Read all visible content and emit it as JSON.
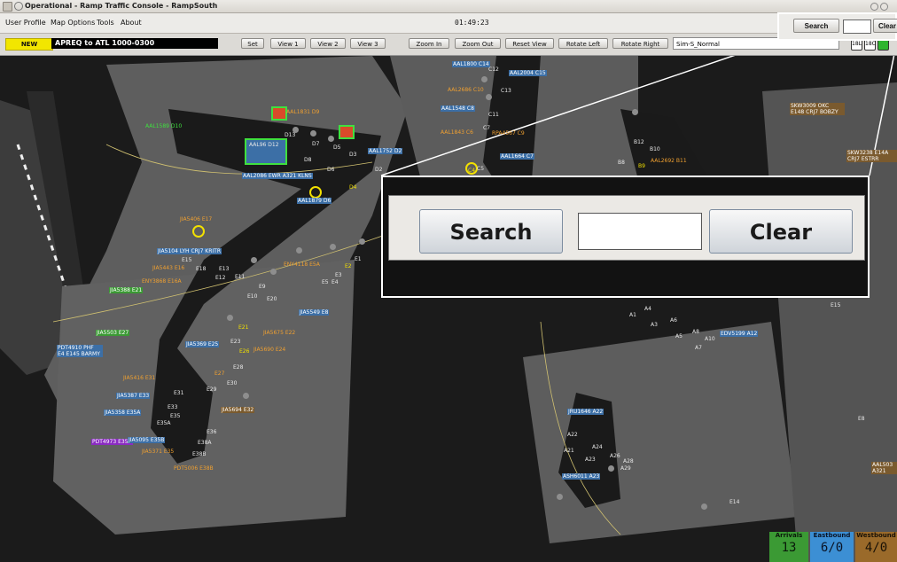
{
  "window": {
    "title": "Operational - Ramp Traffic Console - RampSouth"
  },
  "menu": {
    "items": [
      "User Profile",
      "Map Options",
      "Tools",
      "About"
    ],
    "clock": "01:49:23"
  },
  "toolbar": {
    "new_label": "NEW",
    "apreq_text": "APREQ to ATL 1000-0300",
    "buttons": [
      "Set",
      "View 1",
      "View 2",
      "View 3",
      "Zoom In",
      "Zoom Out",
      "Reset View",
      "Rotate Left",
      "Rotate Right"
    ],
    "sim_value": "Sim-S_Normal",
    "icons": [
      "18L",
      "18C"
    ]
  },
  "search": {
    "search_label": "Search",
    "clear_label": "Clear",
    "value": ""
  },
  "zoom_callout": {
    "search_label": "Search",
    "clear_label": "Clear",
    "value": ""
  },
  "counters": {
    "arrivals": {
      "label": "Arrivals",
      "value": "13"
    },
    "eastbound": {
      "label": "Eastbound",
      "value": "6/0"
    },
    "westbound": {
      "label": "Westbound",
      "value": "4/0"
    }
  },
  "colors": {
    "arrival": "#3b9a34",
    "eastbound": "#3c6fa6",
    "westbound": "#7a5a2e",
    "highlight": "#f2e000"
  },
  "flights": [
    "AAL1589 D10",
    "AAL1831 D9",
    "AAL96 D12",
    "AAL2086 EWR A321 KLNS",
    "AAL1879 D6",
    "AAL1752 D2",
    "JIA5406 E17",
    "JIA5104 LYH CRJ7 KRITR",
    "JIA5443 E16",
    "ENY3868 E16A",
    "JIA5388 E21",
    "ENY4118 E5A",
    "JIA5549 E8",
    "JIA5503 E27",
    "PDT4910 PHF E4 E145 BARMY",
    "JIA5369 E25",
    "JIA5675 E22",
    "JIA5690 E24",
    "JIA5416 E31",
    "JIA5387 E33",
    "JIA5358 E35A",
    "JIA5694 E32",
    "PDT4973 E35B",
    "JIA5095 E35B",
    "JIA5371 E35",
    "PDT5006 E38B",
    "AAL1800 C14",
    "AAL2004 C15",
    "AAL2686 C10",
    "AAL1548 C8",
    "AAL1843 C6",
    "RPA4567 C9",
    "AAL1664 C7",
    "AAL2692 B11",
    "SKW3009 OKC E148 CRJ7 BOBZY",
    "SKW3238 E14A CRJ7 ESTRR",
    "EDV5199 A12",
    "JRU1646 A22",
    "ASH6011 A23",
    "AAL503 A321"
  ],
  "gates": [
    "D13",
    "D7",
    "D5",
    "D3",
    "D8",
    "D6",
    "D4",
    "D2",
    "E1",
    "E2",
    "E3",
    "E4",
    "E5",
    "E9",
    "E10",
    "E11",
    "E12",
    "E13",
    "E15",
    "E18",
    "E20",
    "E21",
    "E23",
    "E26",
    "E27",
    "E28",
    "E29",
    "E30",
    "E31",
    "E33",
    "E35",
    "E35A",
    "E36",
    "E38A",
    "E38B",
    "C4",
    "C5",
    "C7",
    "C11",
    "C12",
    "C13",
    "A1",
    "A3",
    "A4",
    "A5",
    "A6",
    "A7",
    "A8",
    "A10",
    "A21",
    "A22",
    "A23",
    "A24",
    "A26",
    "A28",
    "A29",
    "B8",
    "B9",
    "B10",
    "B12",
    "E14",
    "E15",
    "E8"
  ]
}
